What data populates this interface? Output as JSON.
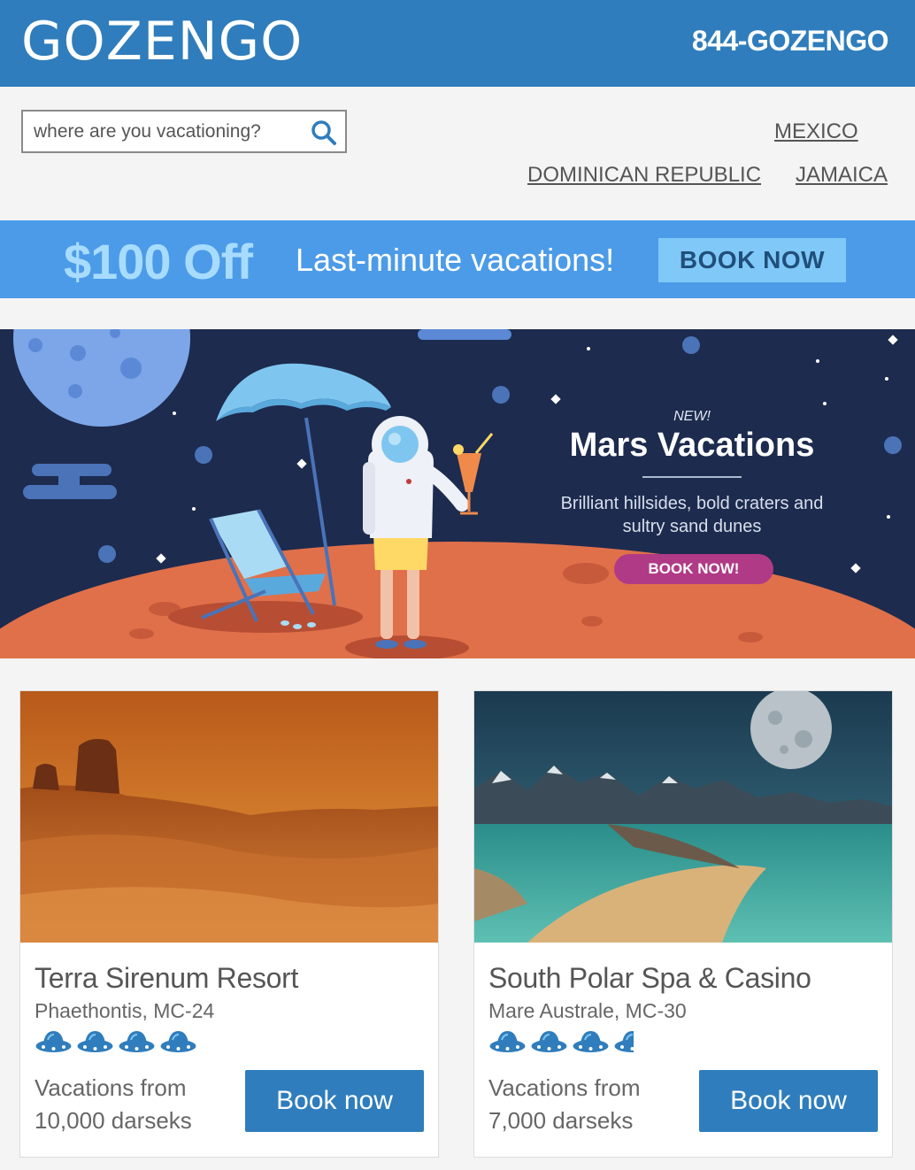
{
  "header": {
    "logo": "GOZENGO",
    "phone": "844-GOZENGO",
    "background": "#2f7dbc"
  },
  "search": {
    "placeholder": "where are you vacationing?",
    "icon": "search-icon"
  },
  "nav": {
    "links": [
      "MEXICO",
      "DOMINICAN REPUBLIC",
      "JAMAICA"
    ]
  },
  "promo": {
    "amount": "$100 Off",
    "text": "Last-minute vacations!",
    "button": "BOOK NOW",
    "background": "#4c9be8"
  },
  "hero": {
    "badge": "NEW!",
    "title": "Mars Vacations",
    "description": "Brilliant hillsides, bold craters and sultry sand dunes",
    "button": "BOOK NOW!",
    "background": "#1d2b4e",
    "button_color": "#b03a86"
  },
  "cards": [
    {
      "title": "Terra Sirenum Resort",
      "location": "Phaethontis, MC-24",
      "rating": 4,
      "rating_icon": "ufo-icon",
      "price_text": "Vacations from 10,000 darseks",
      "button": "Book now"
    },
    {
      "title": "South Polar Spa & Casino",
      "location": "Mare Australe, MC-30",
      "rating": 3.5,
      "rating_icon": "ufo-icon",
      "price_text": "Vacations from 7,000 darseks",
      "button": "Book now"
    }
  ],
  "accent_button_color": "#2f7dbc"
}
